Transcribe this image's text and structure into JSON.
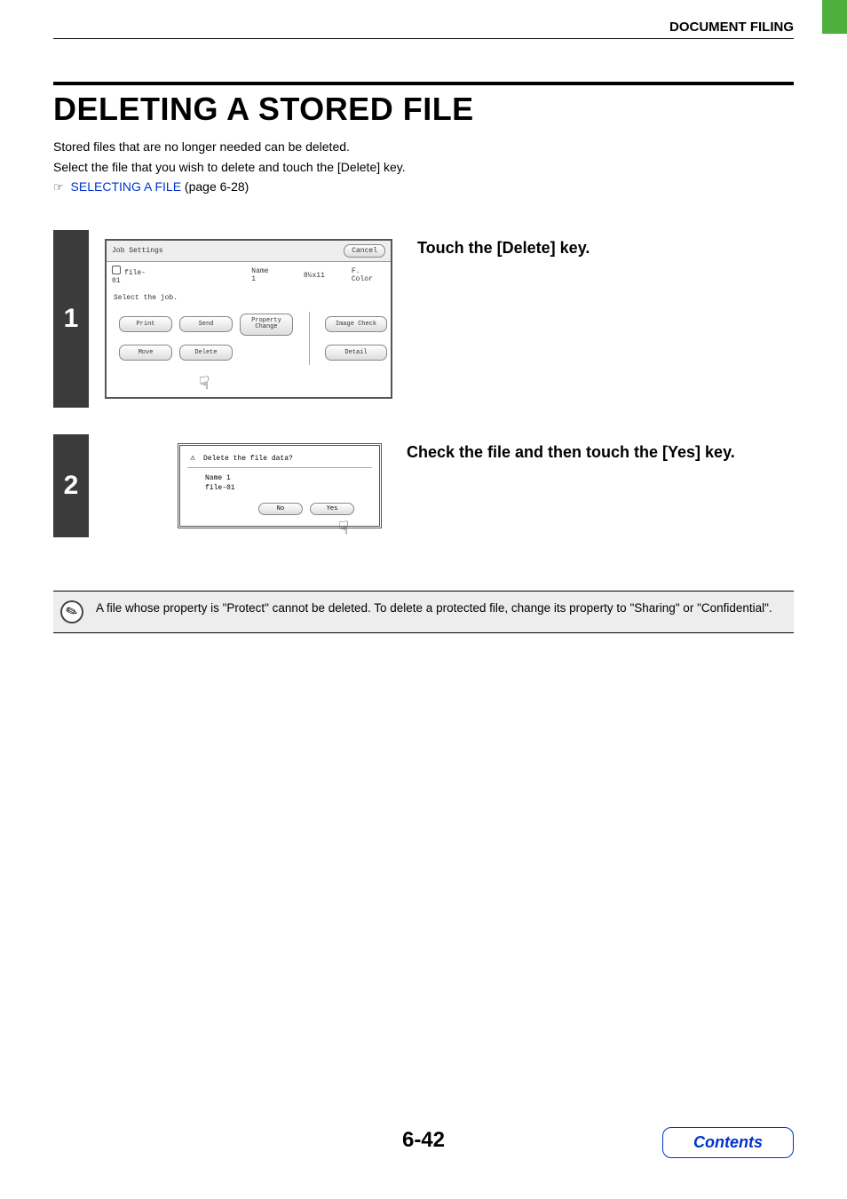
{
  "header": {
    "section": "DOCUMENT FILING"
  },
  "title": "DELETING A STORED FILE",
  "intro": {
    "line1": "Stored files that are no longer needed can be deleted.",
    "line2": "Select the file that you wish to delete and touch the [Delete] key.",
    "pointer": "☞",
    "link_text": "SELECTING A FILE",
    "link_page": " (page 6-28)"
  },
  "step1": {
    "num": "1",
    "heading": "Touch the [Delete] key.",
    "panel": {
      "title": "Job Settings",
      "cancel": "Cancel",
      "file_name": "file-01",
      "user": "Name 1",
      "size": "8½x11",
      "color": "F. Color",
      "prompt": "Select the job.",
      "btn_print": "Print",
      "btn_send": "Send",
      "btn_property": "Property Change",
      "btn_image": "Image Check",
      "btn_move": "Move",
      "btn_delete": "Delete",
      "btn_detail": "Detail"
    }
  },
  "step2": {
    "num": "2",
    "heading": "Check the file and then touch the [Yes] key.",
    "panel": {
      "question": "Delete the file data?",
      "line1": "Name 1",
      "line2": "file-01",
      "no": "No",
      "yes": "Yes"
    }
  },
  "note": {
    "text": "A file whose property is \"Protect\" cannot be deleted. To delete a protected file, change its property to \"Sharing\" or \"Confidential\"."
  },
  "footer": {
    "page": "6-42",
    "contents": "Contents"
  }
}
